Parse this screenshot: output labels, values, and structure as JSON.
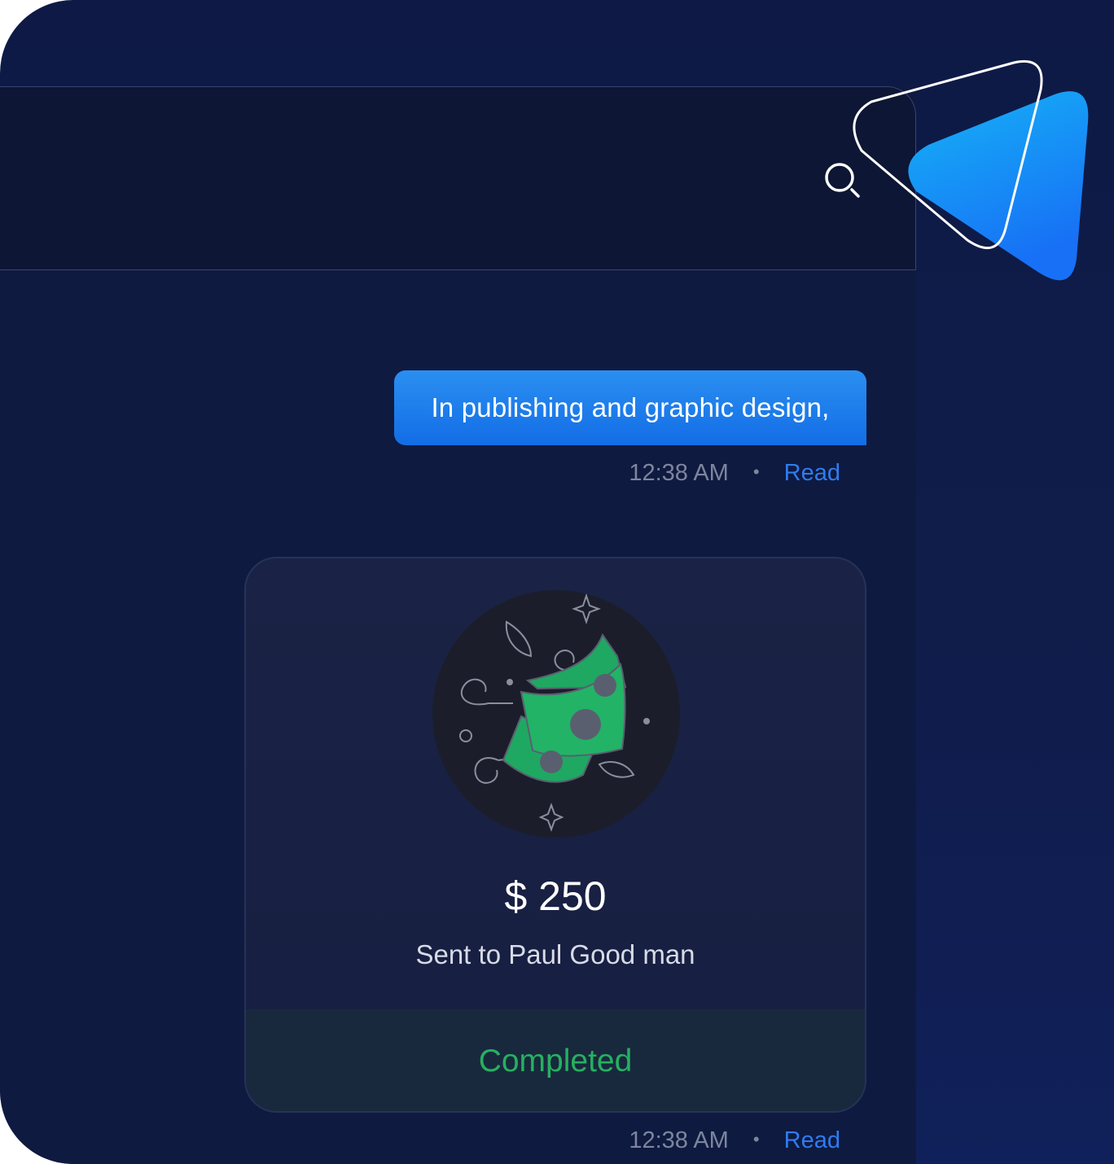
{
  "header": {
    "search_icon": "search-icon",
    "logo_icon": "play-triangle-logo"
  },
  "messages": [
    {
      "type": "text",
      "text": "In publishing and graphic design,",
      "time": "12:38 AM",
      "separator": "•",
      "status": "Read"
    },
    {
      "type": "payment",
      "illustration": "flying-money-icon",
      "amount": "$ 250",
      "recipient": "Sent to Paul Good man",
      "payment_status": "Completed",
      "time": "12:38 AM",
      "separator": "•",
      "status": "Read"
    }
  ],
  "colors": {
    "background": "#0e1a45",
    "bubble": "#1f7eec",
    "read_status": "#2f7cf0",
    "completed": "#27b05f",
    "money_green": "#1fa862"
  }
}
